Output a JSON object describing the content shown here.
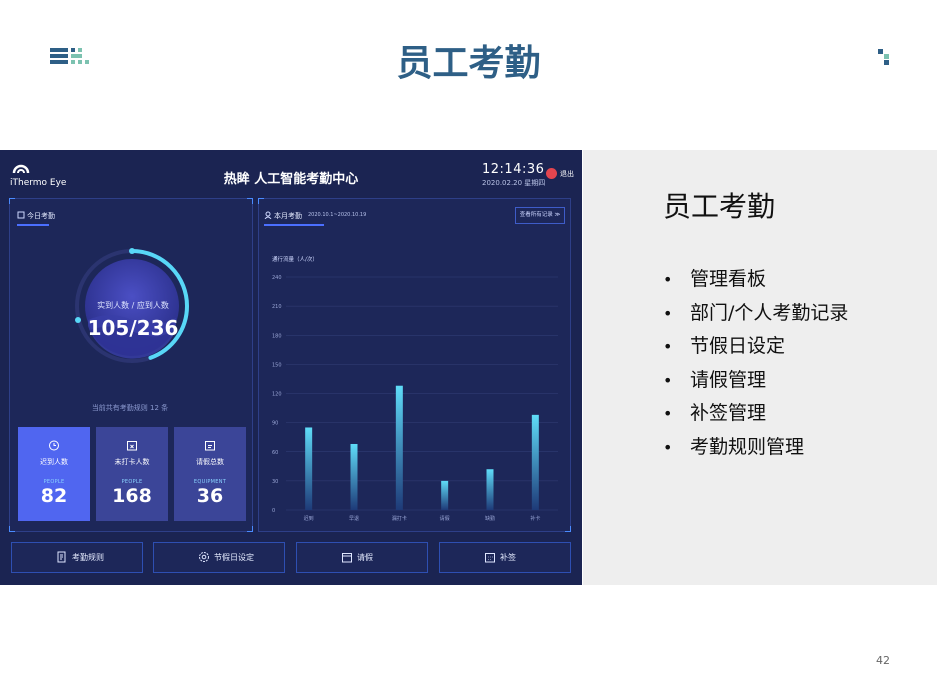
{
  "slide": {
    "title": "员工考勤",
    "page_number": "42"
  },
  "right_panel": {
    "title": "员工考勤",
    "bullets": [
      "管理看板",
      "部门/个人考勤记录",
      "节假日设定",
      "请假管理",
      "补签管理",
      "考勤规则管理"
    ]
  },
  "dashboard": {
    "logo_text": "iThermo Eye",
    "app_title": "热眸 人工智能考勤中心",
    "time": "12:14:36",
    "date": "2020.02.20  星期四",
    "logout": "退出",
    "today": {
      "tab_label": "今日考勤",
      "ring_label": "实到人数 / 应到人数",
      "ring_value": "105/236",
      "ring_progress": 0.445,
      "rule_count_text": "当前共有考勤规则 12 条",
      "cards": [
        {
          "label": "迟到人数",
          "sub": "PEOPLE",
          "value": "82",
          "icon": "alarm-clock-icon",
          "active": true
        },
        {
          "label": "未打卡人数",
          "sub": "PEOPLE",
          "value": "168",
          "icon": "calendar-x-icon",
          "active": false
        },
        {
          "label": "请假总数",
          "sub": "EQUIPMENT",
          "value": "36",
          "icon": "calendar-edit-icon",
          "active": false
        }
      ]
    },
    "month": {
      "tab_label": "本月考勤",
      "date_range": "2020.10.1~2020.10.19",
      "view_all": "查看所有记录 ≫"
    },
    "nav_buttons": [
      {
        "label": "考勤规则",
        "icon": "rule-document-icon"
      },
      {
        "label": "节假日设定",
        "icon": "gear-icon"
      },
      {
        "label": "请假",
        "icon": "calendar-leave-icon"
      },
      {
        "label": "补签",
        "icon": "calendar-grid-icon"
      }
    ]
  },
  "colors": {
    "title_blue": "#2e5f86",
    "dashboard_bg": "#1b2452",
    "accent": "#5066f0",
    "bar_cyan": "#57d3f5"
  },
  "chart_data": {
    "type": "bar",
    "ylabel": "通行流量（人/次）",
    "y_ticks": [
      0,
      30,
      60,
      90,
      120,
      150,
      180,
      210,
      240
    ],
    "ylim": [
      0,
      240
    ],
    "categories": [
      "迟到",
      "早退",
      "漏打卡",
      "请假",
      "缺勤",
      "补卡"
    ],
    "values": [
      85,
      68,
      128,
      30,
      42,
      98
    ],
    "grid": true
  }
}
